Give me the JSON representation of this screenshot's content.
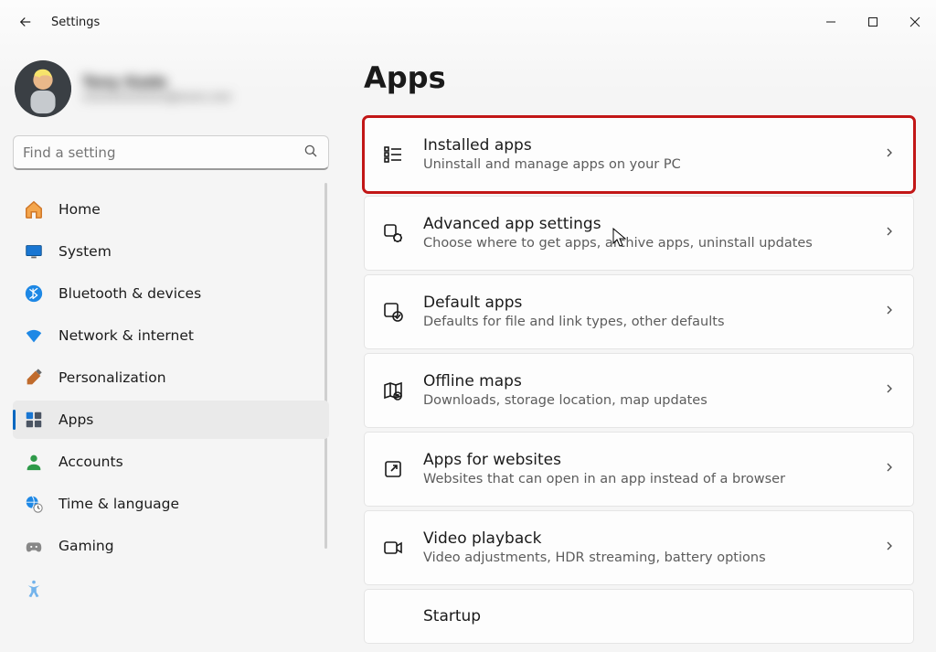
{
  "titlebar": {
    "title": "Settings"
  },
  "profile": {
    "name": "Tony Kade",
    "email": "xxxxxxxxxxxx@xxxx.xxx"
  },
  "search": {
    "placeholder": "Find a setting"
  },
  "sidebar": {
    "items": [
      {
        "label": "Home"
      },
      {
        "label": "System"
      },
      {
        "label": "Bluetooth & devices"
      },
      {
        "label": "Network & internet"
      },
      {
        "label": "Personalization"
      },
      {
        "label": "Apps"
      },
      {
        "label": "Accounts"
      },
      {
        "label": "Time & language"
      },
      {
        "label": "Gaming"
      }
    ],
    "active_index": 5
  },
  "page": {
    "heading": "Apps",
    "cards": [
      {
        "title": "Installed apps",
        "desc": "Uninstall and manage apps on your PC"
      },
      {
        "title": "Advanced app settings",
        "desc": "Choose where to get apps, archive apps, uninstall updates"
      },
      {
        "title": "Default apps",
        "desc": "Defaults for file and link types, other defaults"
      },
      {
        "title": "Offline maps",
        "desc": "Downloads, storage location, map updates"
      },
      {
        "title": "Apps for websites",
        "desc": "Websites that can open in an app instead of a browser"
      },
      {
        "title": "Video playback",
        "desc": "Video adjustments, HDR streaming, battery options"
      },
      {
        "title": "Startup",
        "desc": ""
      }
    ]
  }
}
